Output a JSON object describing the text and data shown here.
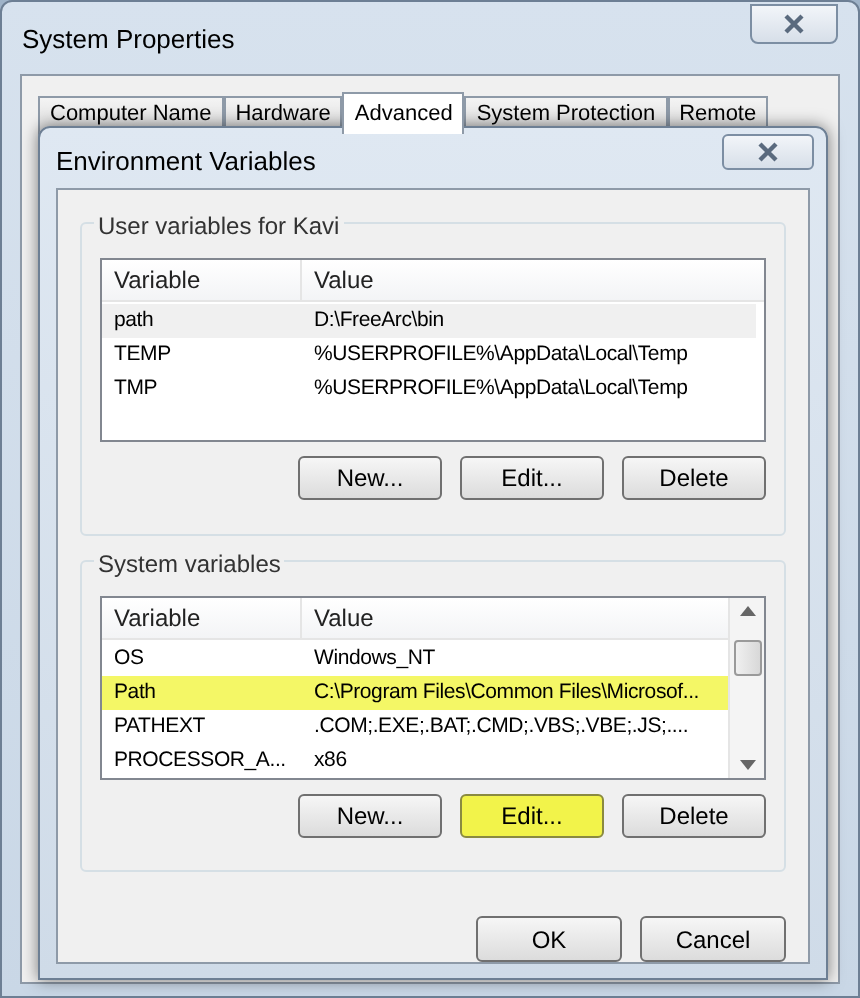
{
  "window": {
    "title": "System Properties"
  },
  "tabs": [
    {
      "label": "Computer Name",
      "selected": false
    },
    {
      "label": "Hardware",
      "selected": false
    },
    {
      "label": "Advanced",
      "selected": true
    },
    {
      "label": "System Protection",
      "selected": false
    },
    {
      "label": "Remote",
      "selected": false
    }
  ],
  "dialog": {
    "title": "Environment Variables",
    "groups": [
      {
        "label": "User variables for Kavi",
        "columns": [
          "Variable",
          "Value"
        ],
        "scrollbar": false,
        "rows": [
          {
            "cells": [
              "path",
              "D:\\FreeArc\\bin"
            ],
            "selected": true,
            "highlighted": false
          },
          {
            "cells": [
              "TEMP",
              "%USERPROFILE%\\AppData\\Local\\Temp"
            ],
            "selected": false,
            "highlighted": false
          },
          {
            "cells": [
              "TMP",
              "%USERPROFILE%\\AppData\\Local\\Temp"
            ],
            "selected": false,
            "highlighted": false
          }
        ],
        "buttons": [
          {
            "label": "New...",
            "highlighted": false
          },
          {
            "label": "Edit...",
            "highlighted": false
          },
          {
            "label": "Delete",
            "highlighted": false
          }
        ]
      },
      {
        "label": "System variables",
        "columns": [
          "Variable",
          "Value"
        ],
        "scrollbar": true,
        "rows": [
          {
            "cells": [
              "OS",
              "Windows_NT"
            ],
            "selected": false,
            "highlighted": false
          },
          {
            "cells": [
              "Path",
              "C:\\Program Files\\Common Files\\Microsof..."
            ],
            "selected": false,
            "highlighted": true
          },
          {
            "cells": [
              "PATHEXT",
              ".COM;.EXE;.BAT;.CMD;.VBS;.VBE;.JS;...."
            ],
            "selected": false,
            "highlighted": false
          },
          {
            "cells": [
              "PROCESSOR_A...",
              "x86"
            ],
            "selected": false,
            "highlighted": false
          }
        ],
        "buttons": [
          {
            "label": "New...",
            "highlighted": false
          },
          {
            "label": "Edit...",
            "highlighted": true
          },
          {
            "label": "Delete",
            "highlighted": false
          }
        ]
      }
    ],
    "buttons": [
      "OK",
      "Cancel"
    ]
  }
}
